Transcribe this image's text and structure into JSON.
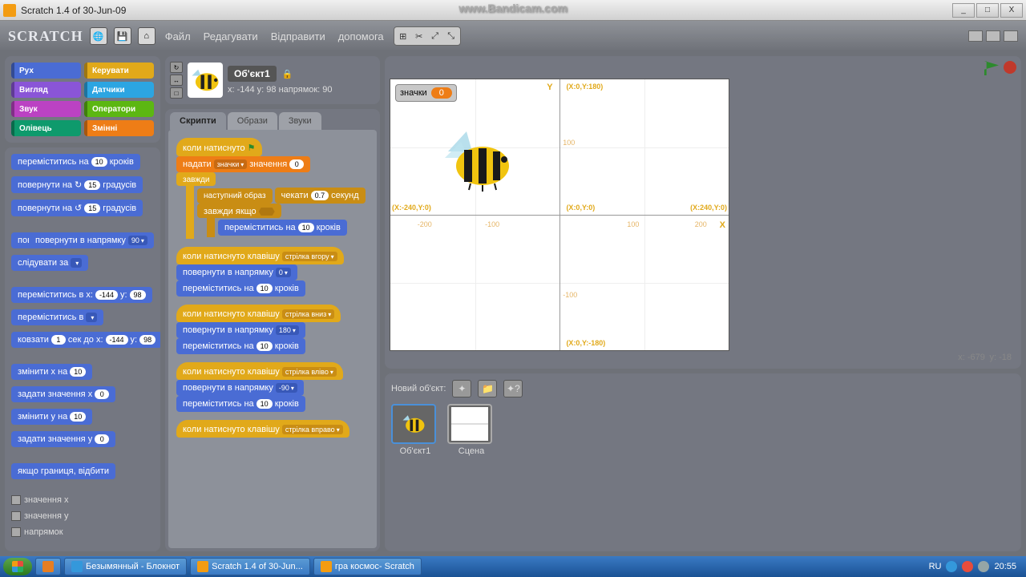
{
  "watermark": "www.Bandicam.com",
  "window": {
    "title": "Scratch 1.4 of 30-Jun-09",
    "min": "_",
    "max": "□",
    "close": "X"
  },
  "toolbar": {
    "logo": "SCRATCH",
    "menu": {
      "file": "Файл",
      "edit": "Редагувати",
      "share": "Відправити",
      "help": "допомога"
    }
  },
  "categories": {
    "motion": "Рух",
    "control": "Керувати",
    "looks": "Вигляд",
    "sensing": "Датчики",
    "sound": "Звук",
    "operators": "Оператори",
    "pen": "Олівець",
    "variables": "Змінні"
  },
  "palette": {
    "b1": {
      "t1": "переміститись на",
      "v": "10",
      "t2": "кроків"
    },
    "b2": {
      "t1": "повернути на",
      "icon": "↻",
      "v": "15",
      "t2": "градусів"
    },
    "b3": {
      "t1": "повернути на",
      "icon": "↺",
      "v": "15",
      "t2": "градусів"
    },
    "b4": {
      "t1": "повернути в напрямку",
      "v": "90"
    },
    "b4p": {
      "t1": "пове"
    },
    "b5": {
      "t1": "слідувати за",
      "v": ""
    },
    "b6": {
      "t1": "переміститись в x:",
      "v1": "-144",
      "t2": "y:",
      "v2": "98"
    },
    "b7": {
      "t1": "переміститись в",
      "v": ""
    },
    "b8": {
      "t1": "ковзати",
      "v1": "1",
      "t2": "сек до x:",
      "v2": "-144",
      "t3": "y:",
      "v3": "98"
    },
    "b9": {
      "t1": "змінити x на",
      "v": "10"
    },
    "b10": {
      "t1": "задати значення x",
      "v": "0"
    },
    "b11": {
      "t1": "змінити y на",
      "v": "10"
    },
    "b12": {
      "t1": "задати значення y",
      "v": "0"
    },
    "b13": {
      "t1": "якщо границя, відбити"
    },
    "c1": "значення x",
    "c2": "значення y",
    "c3": "напрямок"
  },
  "sprite": {
    "name": "Об'єкт1",
    "pos": "x: -144 y: 98  напрямок: 90",
    "tabs": {
      "scripts": "Скрипти",
      "costumes": "Образи",
      "sounds": "Звуки"
    }
  },
  "scripts": {
    "s1_hat": "коли натиснуто",
    "s1_set": {
      "t1": "надати",
      "var": "значки",
      "t2": "значення",
      "v": "0"
    },
    "forever": "завжди",
    "nextcostume": "наступний образ",
    "wait": {
      "t1": "чекати",
      "v": "0.7",
      "t2": "секунд"
    },
    "foreverif": "завжди якщо",
    "move": {
      "t1": "переміститись на",
      "v": "10",
      "t2": "кроків"
    },
    "keyhat": "коли натиснуто клавішу",
    "key_up": "стрілка вгору",
    "key_down": "стрілка вниз",
    "key_left": "стрілка вліво",
    "key_right": "стрілка вправо",
    "point": {
      "t1": "повернути в напрямку",
      "v0": "0",
      "v180": "180",
      "vn90": "-90"
    }
  },
  "stage": {
    "var_name": "значки",
    "var_val": "0",
    "Y": "Y",
    "X": "X",
    "c_topright": "(X:0,Y:180)",
    "c_left": "(X:-240,Y:0)",
    "c_center": "(X:0,Y:0)",
    "c_right": "(X:240,Y:0)",
    "c_bottom": "(X:0,Y:-180)",
    "t_n200": "-200",
    "t_n100": "-100",
    "t_100": "100",
    "t_200": "200",
    "mousepos": {
      "x": "x: -679",
      "y": "y: -18"
    }
  },
  "spritelist": {
    "newobj": "Новий об'єкт:",
    "sprite1": "Об'єкт1",
    "scene": "Сцена"
  },
  "taskbar": {
    "items": [
      "",
      "Безымянный - Блокнот",
      "Scratch 1.4 of 30-Jun...",
      "гра космос- Scratch"
    ],
    "lang": "RU",
    "time": "20:55"
  }
}
